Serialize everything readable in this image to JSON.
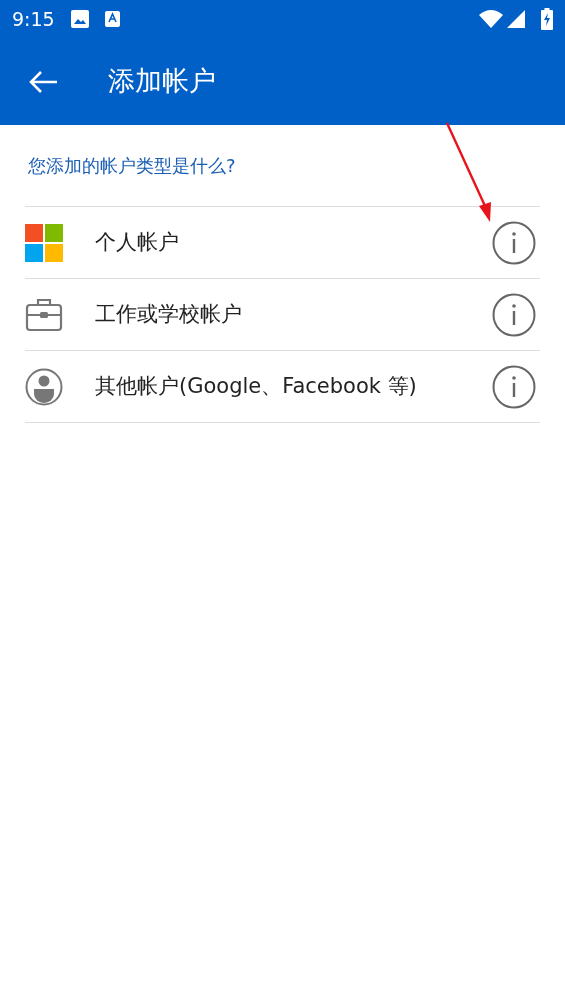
{
  "status_bar": {
    "time": "9:15"
  },
  "app_bar": {
    "title": "添加帐户"
  },
  "question": "您添加的帐户类型是什么?",
  "accounts": [
    {
      "kind": "squares",
      "label": "个人帐户"
    },
    {
      "kind": "briefcase",
      "label": "工作或学校帐户"
    },
    {
      "kind": "person",
      "label": "其他帐户(Google、Facebook 等)"
    }
  ],
  "annotations": [
    {
      "kind": "arrow",
      "color": "#e8141c"
    }
  ]
}
